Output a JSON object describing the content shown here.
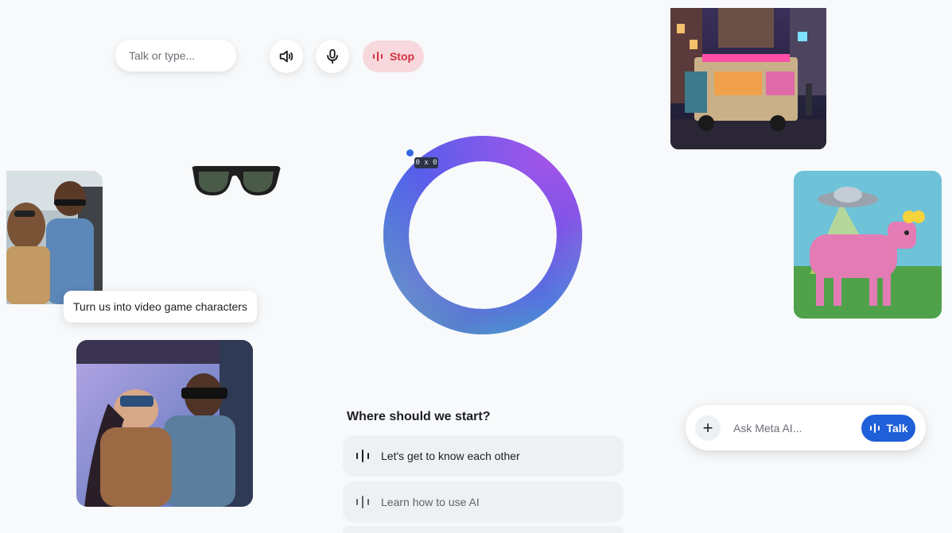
{
  "toolbar": {
    "talk_placeholder": "Talk or type...",
    "speaker_icon": "speaker-icon",
    "mic_icon": "microphone-icon",
    "stop_label": "Stop",
    "accent_stop": "#d2323f"
  },
  "debug_badge": "0 x 0",
  "gallery": {
    "caption_chip": "Turn us into video game characters"
  },
  "start": {
    "title": "Where should we start?",
    "suggestions": [
      {
        "label": "Let's get to know each other"
      },
      {
        "label": "Learn how to use AI"
      }
    ]
  },
  "ask": {
    "placeholder": "Ask Meta AI...",
    "talk_label": "Talk",
    "plus_label": "+",
    "accent": "#1f5fd8"
  }
}
